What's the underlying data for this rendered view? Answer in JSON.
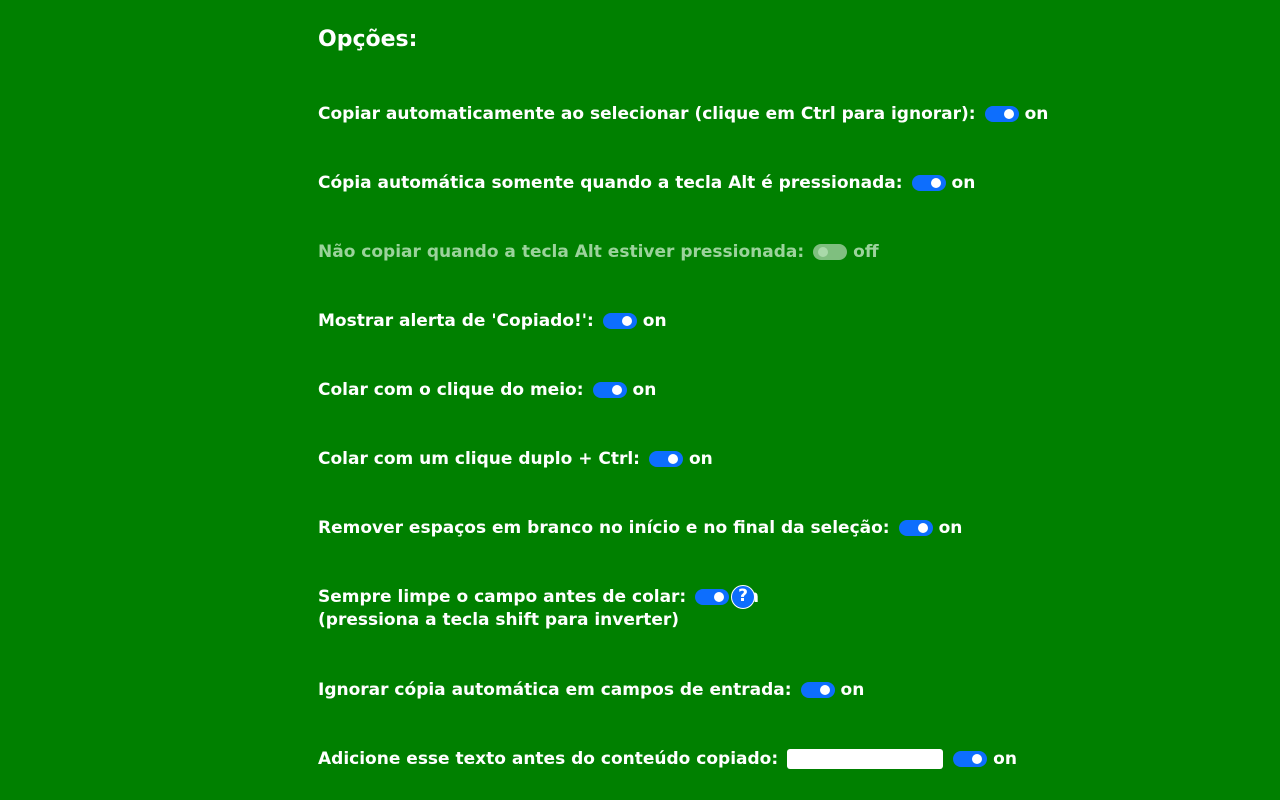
{
  "page": {
    "title": "Opções:"
  },
  "options": [
    {
      "label": "Copiar automaticamente ao selecionar (clique em Ctrl para ignorar):",
      "state": "on"
    },
    {
      "label": "Cópia automática somente quando a tecla Alt é pressionada:",
      "state": "on"
    },
    {
      "label": "Não copiar quando a tecla Alt estiver pressionada:",
      "state": "off"
    },
    {
      "label": "Mostrar alerta de 'Copiado!':",
      "state": "on"
    },
    {
      "label": "Colar com o clique do meio:",
      "state": "on"
    },
    {
      "label": "Colar com um clique duplo + Ctrl:",
      "state": "on"
    },
    {
      "label": "Remover espaços em branco no início e no final da seleção:",
      "state": "on"
    },
    {
      "label": "Sempre limpe o campo antes de colar:",
      "state": "on",
      "sublabel": "(pressiona a tecla shift para inverter)",
      "help_icon": "?"
    },
    {
      "label": "Ignorar cópia automática em campos de entrada:",
      "state": "on"
    },
    {
      "label": "Adicione esse texto antes do conteúdo copiado:",
      "state": "on",
      "input_value": ""
    }
  ],
  "colors": {
    "background": "#008000",
    "toggle_on": "#0d6efd",
    "text": "#ffffff"
  }
}
